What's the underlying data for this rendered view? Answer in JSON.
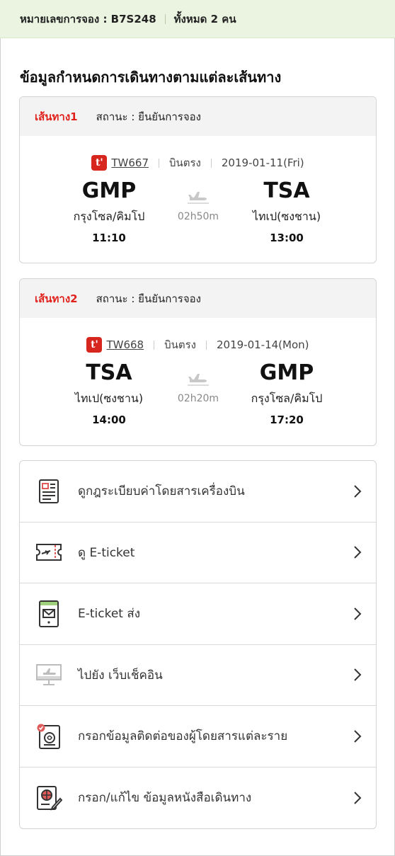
{
  "header": {
    "booking_label": "หมายเลขการจอง : B7S248",
    "total_label": "ทั้งหมด 2 คน"
  },
  "section_title": "ข้อมูลกำหนดการเดินทางตามแต่ละเส้นทาง",
  "routes": [
    {
      "label": "เส้นทาง1",
      "status": "สถานะ : ยืนยันการจอง",
      "flight_no": "TW667",
      "flight_type": "บินตรง",
      "date": "2019-01-11(Fri)",
      "dep_code": "GMP",
      "dep_city": "กรุงโซล/คิมโป",
      "dep_time": "11:10",
      "arr_code": "TSA",
      "arr_city": "ไทเป(ซงชาน)",
      "arr_time": "13:00",
      "duration": "02h50m"
    },
    {
      "label": "เส้นทาง2",
      "status": "สถานะ : ยืนยันการจอง",
      "flight_no": "TW668",
      "flight_type": "บินตรง",
      "date": "2019-01-14(Mon)",
      "dep_code": "TSA",
      "dep_city": "ไทเป(ซงชาน)",
      "dep_time": "14:00",
      "arr_code": "GMP",
      "arr_city": "กรุงโซล/คิมโป",
      "arr_time": "17:20",
      "duration": "02h20m"
    }
  ],
  "airline_logo_text": "t'",
  "menu": [
    {
      "label": "ดูกฎระเบียบค่าโดยสารเครื่องบิน",
      "icon": "fare-rules-document-icon"
    },
    {
      "label": "ดู E-ticket",
      "icon": "ticket-icon"
    },
    {
      "label": "E-ticket ส่ง",
      "icon": "send-ticket-phone-icon"
    },
    {
      "label": "ไปยัง เว็บเช็คอิน",
      "icon": "web-checkin-monitor-icon"
    },
    {
      "label": "กรอกข้อมูลติดต่อของผู้โดยสารแต่ละราย",
      "icon": "contact-info-icon"
    },
    {
      "label": "กรอก/แก้ไข ข้อมูลหนังสือเดินทาง",
      "icon": "passport-edit-icon"
    }
  ],
  "colors": {
    "header_bg": "#eaf4e1",
    "route_label": "#e0201b",
    "airline": "#d7261e",
    "accent_icon": "#e05a5a"
  }
}
